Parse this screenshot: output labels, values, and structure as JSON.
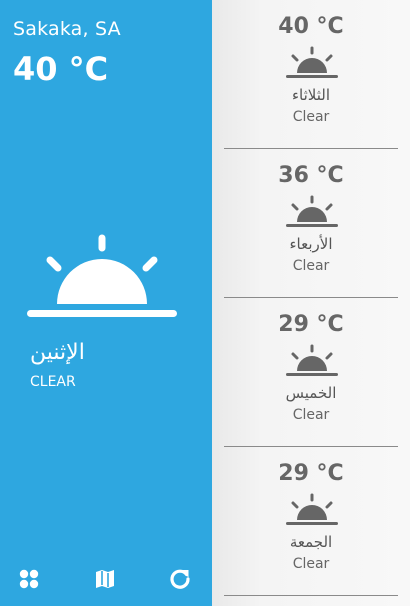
{
  "current": {
    "location": "Sakaka, SA",
    "temperature": "40 °C",
    "day": "الإثنين",
    "condition": "CLEAR",
    "icon": "sunrise-icon"
  },
  "bottom_bar": {
    "icons": [
      "grid-apps-icon",
      "map-icon",
      "refresh-icon"
    ]
  },
  "forecast": [
    {
      "temp": "40 °C",
      "day": "الثلاثاء",
      "condition": "Clear",
      "icon": "sunrise-icon"
    },
    {
      "temp": "36 °C",
      "day": "الأربعاء",
      "condition": "Clear",
      "icon": "sunrise-icon"
    },
    {
      "temp": "29 °C",
      "day": "الخميس",
      "condition": "Clear",
      "icon": "sunrise-icon"
    },
    {
      "temp": "29 °C",
      "day": "الجمعة",
      "condition": "Clear",
      "icon": "sunrise-icon"
    }
  ],
  "colors": {
    "primary_blue": "#2ea7e0",
    "text_gray": "#666666",
    "white": "#ffffff"
  }
}
